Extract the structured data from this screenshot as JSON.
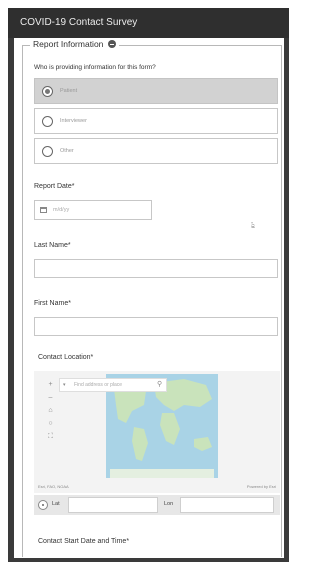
{
  "window": {
    "title": "COVID-19 Contact Survey"
  },
  "section": {
    "title": "Report Information"
  },
  "provider": {
    "question": "Who is providing information for this form?",
    "options": [
      "Patient",
      "Interviewer",
      "Other"
    ],
    "selected": "Patient"
  },
  "report_date": {
    "label": "Report Date*",
    "placeholder": "m/d/yy"
  },
  "last_name": {
    "label": "Last Name*",
    "value": ""
  },
  "first_name": {
    "label": "First Name*",
    "value": ""
  },
  "contact_location": {
    "label": "Contact Location*",
    "map": {
      "search_placeholder": "Find address or place",
      "attribution_left": "Esri, FAO, NOAA",
      "attribution_right": "Powered by Esri",
      "tools": [
        "zoom-in",
        "zoom-out",
        "home",
        "locate",
        "fullscreen"
      ]
    },
    "lat_label": "Lat",
    "lon_label": "Lon",
    "lat_value": "",
    "lon_value": ""
  },
  "contact_start": {
    "label": "Contact Start Date and Time*"
  },
  "colors": {
    "titlebar": "#2f2f2f",
    "selected_option": "#d2d2d2",
    "ocean": "#a9d3e6",
    "land": "#c9e3bb",
    "border": "#c7c7c7"
  }
}
